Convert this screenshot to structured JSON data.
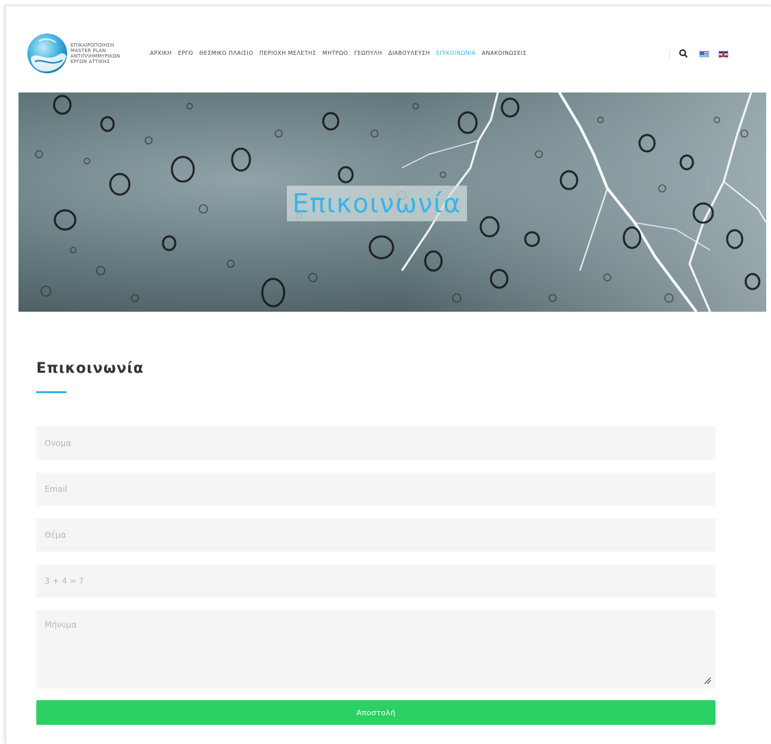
{
  "brand": {
    "logo_lines": [
      "ΕΠΙΚΑΙΡΟΠΟΙΗΣΗ",
      "MASTER PLAN",
      "ΑΝΤΙΠΛΗΜΜΥΡΙΚΩΝ",
      "ΕΡΓΩΝ ΑΤΤΙΚΗΣ"
    ]
  },
  "nav": {
    "items": [
      {
        "label": "ΑΡΧΙΚΗ",
        "active": false
      },
      {
        "label": "ΕΡΓΟ",
        "active": false
      },
      {
        "label": "ΘΕΣΜΙΚΟ ΠΛΑΙΣΙΟ",
        "active": false
      },
      {
        "label": "ΠΕΡΙΟΧΗ ΜΕΛΕΤΗΣ",
        "active": false
      },
      {
        "label": "ΜΗΤΡΩΟ",
        "active": false
      },
      {
        "label": "ΓΕΩΠΥΛΗ",
        "active": false
      },
      {
        "label": "ΔΙΑΒΟΥΛΕΥΣΗ",
        "active": false
      },
      {
        "label": "ΕΠΙΚΟΙΝΩΝΙΑ",
        "active": true
      },
      {
        "label": "ΑΝΑΚΟΙΝΩΣΕΙΣ",
        "active": false
      }
    ],
    "icons": [
      "search-icon",
      "greek-flag-icon",
      "uk-flag-icon"
    ]
  },
  "hero": {
    "title": "Επικοινωνία"
  },
  "contact": {
    "heading": "Επικοινωνία",
    "name_placeholder": "Ονομα",
    "email_placeholder": "Email",
    "subject_placeholder": "Θέμα",
    "captcha_placeholder": "3 + 4 = ?",
    "message_placeholder": "Μήνυμα",
    "submit_label": "Αποστολή"
  },
  "colors": {
    "accent": "#35b6e6",
    "submit": "#2bd163",
    "field_bg": "#f5f5f5"
  }
}
